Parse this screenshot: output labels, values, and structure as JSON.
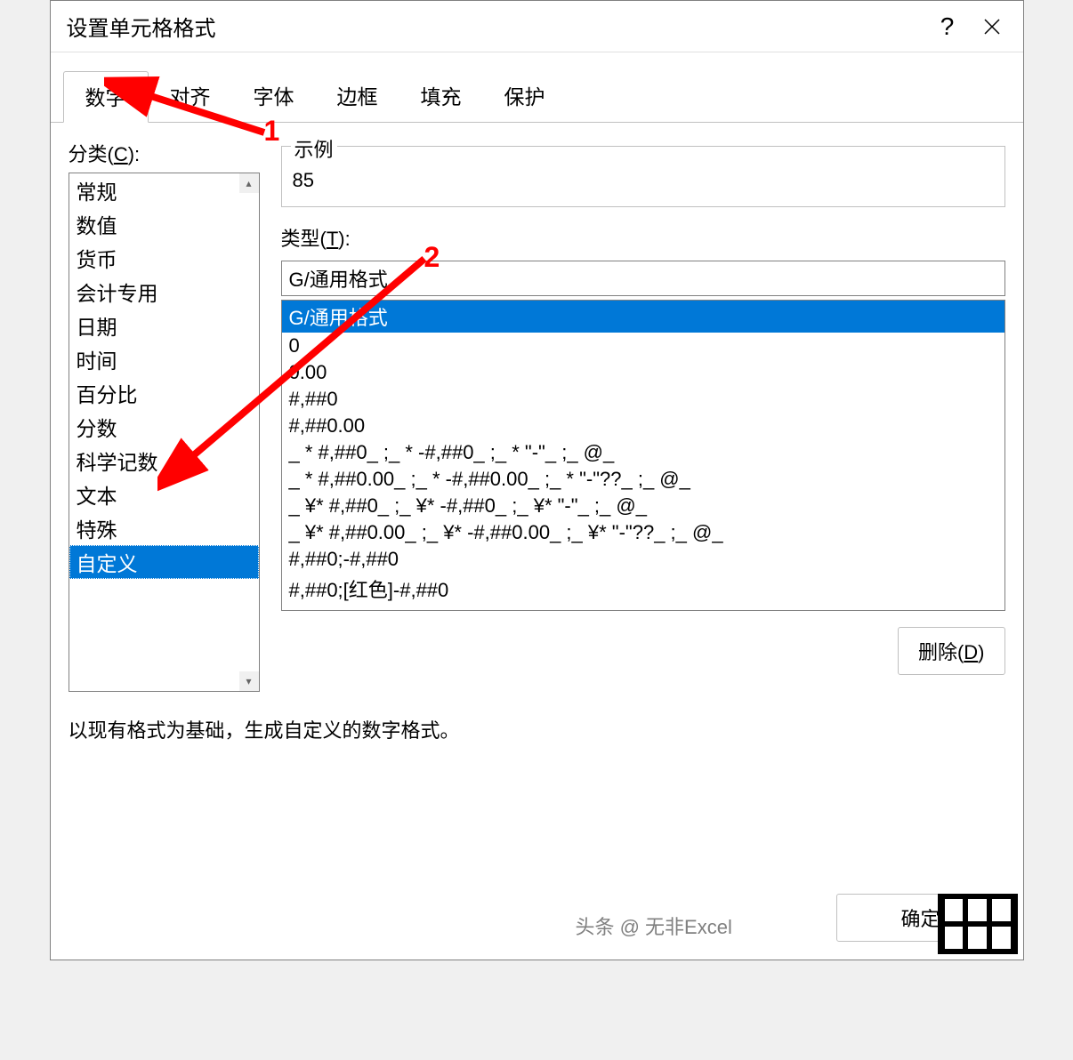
{
  "title": "设置单元格格式",
  "help_icon": "?",
  "tabs": [
    "数字",
    "对齐",
    "字体",
    "边框",
    "填充",
    "保护"
  ],
  "active_tab": 0,
  "category_label_prefix": "分类(",
  "category_label_key": "C",
  "category_label_suffix": "):",
  "categories": [
    "常规",
    "数值",
    "货币",
    "会计专用",
    "日期",
    "时间",
    "百分比",
    "分数",
    "科学记数",
    "文本",
    "特殊",
    "自定义"
  ],
  "selected_category": 11,
  "sample_label": "示例",
  "sample_value": "85",
  "type_label_prefix": "类型(",
  "type_label_key": "T",
  "type_label_suffix": "):",
  "type_input_value": "G/通用格式",
  "type_items": [
    "G/通用格式",
    "0",
    "0.00",
    "#,##0",
    "#,##0.00",
    "_ * #,##0_ ;_ * -#,##0_ ;_ * \"-\"_ ;_ @_",
    "_ * #,##0.00_ ;_ * -#,##0.00_ ;_ * \"-\"??_ ;_ @_",
    "_ ¥* #,##0_ ;_ ¥* -#,##0_ ;_ ¥* \"-\"_ ;_ @_",
    "_ ¥* #,##0.00_ ;_ ¥* -#,##0.00_ ;_ ¥* \"-\"??_ ;_ @_",
    "#,##0;-#,##0",
    "#,##0;[红色]-#,##0"
  ],
  "selected_type": 0,
  "delete_prefix": "删除(",
  "delete_key": "D",
  "delete_suffix": ")",
  "hint_text": "以现有格式为基础，生成自定义的数字格式。",
  "ok_label": "确定",
  "annotation1": "1",
  "annotation2": "2",
  "watermark_text": "头条 @ 无非Excel"
}
